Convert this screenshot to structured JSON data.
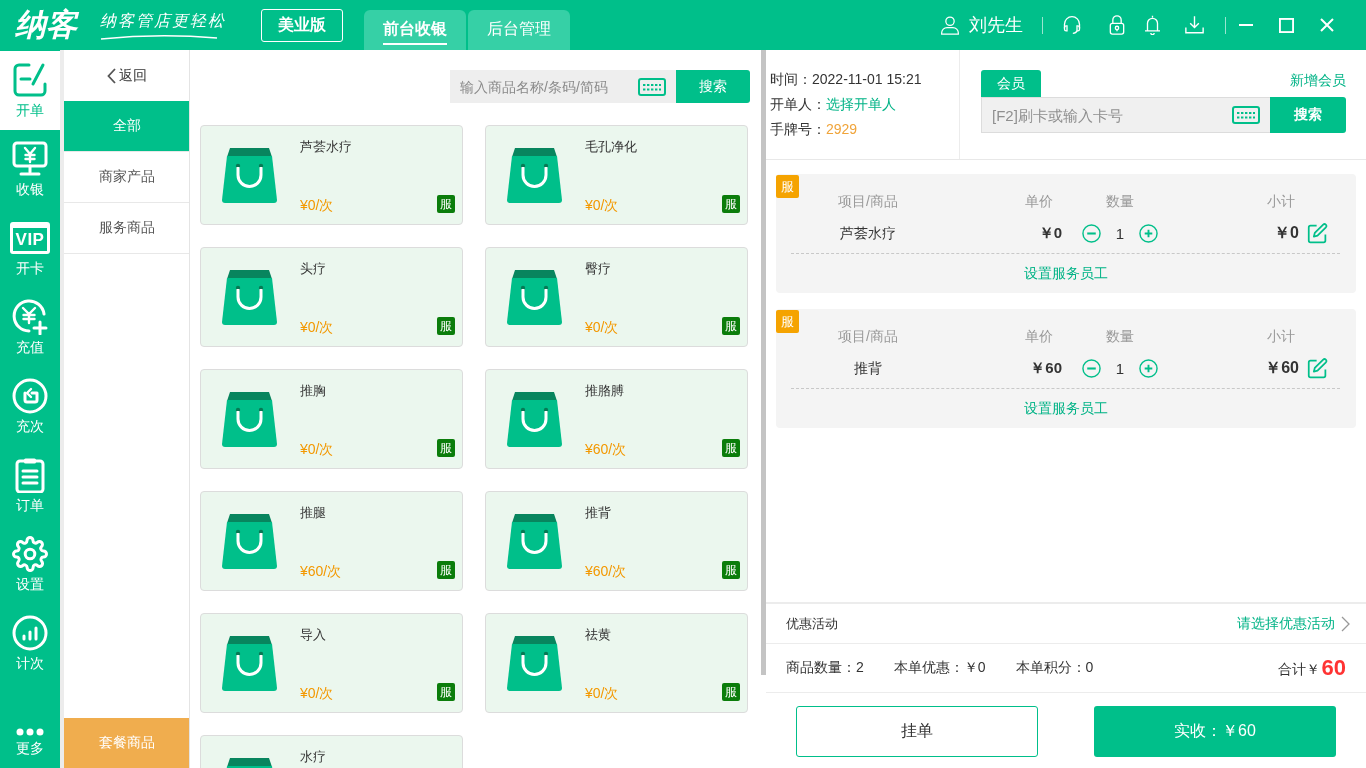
{
  "header": {
    "logo": "纳客",
    "slogan": "纳客管店更轻松",
    "edition": "美业版",
    "tabs": [
      {
        "label": "前台收银",
        "selected": true
      },
      {
        "label": "后台管理",
        "selected": false
      }
    ],
    "user": "刘先生"
  },
  "nav": [
    {
      "label": "开单",
      "selected": true
    },
    {
      "label": "收银",
      "selected": false
    },
    {
      "label": "开卡",
      "selected": false,
      "icon_text": "VIP"
    },
    {
      "label": "充值",
      "selected": false
    },
    {
      "label": "充次",
      "selected": false
    },
    {
      "label": "订单",
      "selected": false
    },
    {
      "label": "设置",
      "selected": false
    },
    {
      "label": "计次",
      "selected": false
    },
    {
      "label": "更多",
      "selected": false
    }
  ],
  "categories": {
    "back": "返回",
    "items": [
      {
        "label": "全部",
        "selected": true
      },
      {
        "label": "商家产品",
        "selected": false
      },
      {
        "label": "服务商品",
        "selected": false
      }
    ],
    "package": "套餐商品"
  },
  "product_search": {
    "placeholder": "输入商品名称/条码/简码",
    "button": "搜索"
  },
  "products": [
    {
      "name": "芦荟水疗",
      "price": "¥0/次",
      "badge": "服"
    },
    {
      "name": "毛孔净化",
      "price": "¥0/次",
      "badge": "服"
    },
    {
      "name": "头疗",
      "price": "¥0/次",
      "badge": "服"
    },
    {
      "name": "臀疗",
      "price": "¥0/次",
      "badge": "服"
    },
    {
      "name": "推胸",
      "price": "¥0/次",
      "badge": "服"
    },
    {
      "name": "推胳膊",
      "price": "¥60/次",
      "badge": "服"
    },
    {
      "name": "推腿",
      "price": "¥60/次",
      "badge": "服"
    },
    {
      "name": "推背",
      "price": "¥60/次",
      "badge": "服"
    },
    {
      "name": "导入",
      "price": "¥0/次",
      "badge": "服"
    },
    {
      "name": "祛黄",
      "price": "¥0/次",
      "badge": "服"
    },
    {
      "name": "水疗"
    }
  ],
  "order_info": {
    "time_label": "时间：",
    "time": "2022-11-01 15:21",
    "operator_label": "开单人：",
    "operator": "选择开单人",
    "tag_label": "手牌号：",
    "tag": "2929"
  },
  "member": {
    "tab": "会员",
    "add": "新增会员",
    "placeholder": "[F2]刷卡或输入卡号",
    "button": "搜索"
  },
  "order_items": [
    {
      "badge": "服",
      "columns": [
        "项目/商品",
        "单价",
        "数量",
        "小计"
      ],
      "name": "芦荟水疗",
      "unit_price": "￥0",
      "quantity": "1",
      "subtotal": "￥0",
      "staff_link": "设置服务员工"
    },
    {
      "badge": "服",
      "columns": [
        "项目/商品",
        "单价",
        "数量",
        "小计"
      ],
      "name": "推背",
      "unit_price": "￥60",
      "quantity": "1",
      "subtotal": "￥60",
      "staff_link": "设置服务员工"
    }
  ],
  "promotion": {
    "label": "优惠活动",
    "link": "请选择优惠活动"
  },
  "summary": {
    "count": "商品数量：2",
    "discount": "本单优惠：￥0",
    "points": "本单积分：0",
    "total_label": "合计￥",
    "total": "60"
  },
  "actions": {
    "hold": "挂单",
    "pay": "实收：￥60"
  }
}
